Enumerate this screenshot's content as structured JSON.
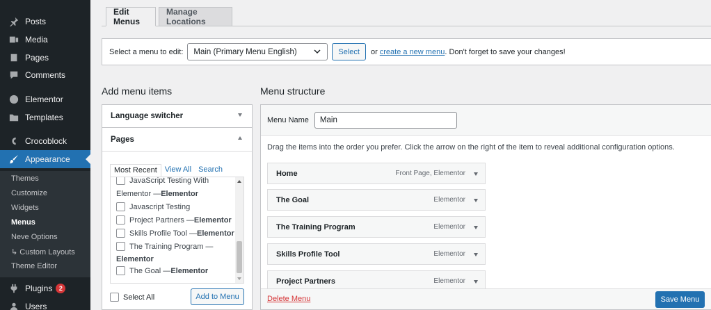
{
  "sidebar": {
    "items": [
      {
        "label": "Posts",
        "icon": "pin-icon"
      },
      {
        "label": "Media",
        "icon": "media-icon"
      },
      {
        "label": "Pages",
        "icon": "pages-icon"
      },
      {
        "label": "Comments",
        "icon": "comments-icon"
      },
      {
        "label": "Elementor",
        "icon": "elementor-icon"
      },
      {
        "label": "Templates",
        "icon": "folder-icon"
      },
      {
        "label": "Crocoblock",
        "icon": "crocoblock-icon"
      },
      {
        "label": "Appearance",
        "icon": "brush-icon"
      },
      {
        "label": "Plugins",
        "icon": "plugin-icon",
        "badge": "2"
      },
      {
        "label": "Users",
        "icon": "users-icon"
      }
    ],
    "submenu": [
      "Themes",
      "Customize",
      "Widgets",
      "Menus",
      "Neve Options",
      "↳ Custom Layouts",
      "Theme Editor"
    ]
  },
  "tabs": [
    "Edit Menus",
    "Manage Locations"
  ],
  "select_bar": {
    "label": "Select a menu to edit:",
    "selected": "Main (Primary Menu English)",
    "button": "Select",
    "or_text": "or",
    "create_link": "create a new menu",
    "suffix": ". Don't forget to save your changes!"
  },
  "add_items": {
    "heading": "Add menu items",
    "sections": [
      "Language switcher",
      "Pages"
    ],
    "page_tabs": [
      "Most Recent",
      "View All",
      "Search"
    ],
    "pages_list": {
      "l1": "JavaScript Testing With",
      "l1b_pre": "Elementor — ",
      "l1b_bold": "Elementor",
      "l2": "Javascript Testing",
      "l3": "Project Partners — ",
      "l3b": "Elementor",
      "l4": "Skills Profile Tool — ",
      "l4b": "Elementor",
      "l5": "The Training Program —",
      "l5b": "Elementor",
      "l6": "The Goal — ",
      "l6b": "Elementor"
    },
    "select_all": "Select All",
    "add_button": "Add to Menu"
  },
  "structure": {
    "heading": "Menu structure",
    "menu_name_label": "Menu Name",
    "menu_name_value": "Main",
    "help": "Drag the items into the order you prefer. Click the arrow on the right of the item to reveal additional configuration options.",
    "items": [
      {
        "title": "Home",
        "meta": "Front Page, Elementor"
      },
      {
        "title": "The Goal",
        "meta": "Elementor"
      },
      {
        "title": "The Training Program",
        "meta": "Elementor"
      },
      {
        "title": "Skills Profile Tool",
        "meta": "Elementor"
      },
      {
        "title": "Project Partners",
        "meta": "Elementor"
      }
    ],
    "delete_label": "Delete Menu",
    "save_label": "Save Menu"
  }
}
